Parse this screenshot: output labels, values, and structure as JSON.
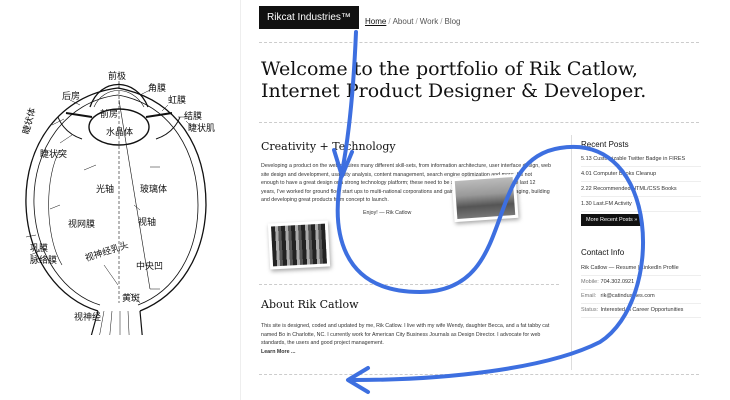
{
  "eye_labels": {
    "anterior_pole": "前极",
    "cornea": "角膜",
    "iris": "虹膜",
    "posterior_chamber": "后房",
    "anterior_chamber": "前房",
    "lens": "水晶体",
    "conjunctiva": "结膜",
    "ciliary_body_right": "睫状肌",
    "ciliary_body_left": "睫状体",
    "ciliary_process": "睫状突",
    "optic_axis": "光轴",
    "vitreous": "玻璃体",
    "visual_axis": "视轴",
    "retina": "视网膜",
    "sclera": "巩膜",
    "choroid": "脉络膜",
    "optic_disc": "视神经乳头",
    "fovea": "中央凹",
    "macula": "黄斑",
    "optic_nerve": "视神经"
  },
  "site": {
    "brand": "Rikcat Industries™",
    "nav": [
      "Home",
      "About",
      "Work",
      "Blog"
    ],
    "headline_line1": "Welcome to the portfolio of Rik Catlow,",
    "headline_line2": "Internet Product Designer & Developer.",
    "creativity": {
      "heading": "Creativity + Technology",
      "p1": "Developing a product on the web requires many different skill-sets, from information architecture, user interface design, web site design and development, usability analysis, content management, search engine optimization and more. It's not enough to have a great design or a strong technology platform; these need to be seamlessly integrated. In the last 12 years, I've worked for ground floor start ups to multi-national corporations and gained the experience for managing, building and developing great products from concept to launch.",
      "p2": "Enjoy! — Rik Catlow"
    },
    "about": {
      "heading": "About Rik Catlow",
      "text": "This site is designed, coded and updated by me, Rik Catlow. I live with my wife Wendy, daughter Becca, and a fat tabby cat named Bo in Charlotte, NC. I currently work for American City Business Journals as Design Director. I advocate for web standards, the users and good project management.",
      "more": "Learn More ..."
    },
    "recent_posts": {
      "heading": "Recent Posts",
      "items": [
        "5.13  Customizable Twitter Badge in FIRES",
        "4.01  Computer Books Cleanup",
        "2.22  Recommended HTML/CSS Books",
        "1.30  Last.FM Activity"
      ],
      "button": "More Recent Posts »"
    },
    "contact": {
      "heading": "Contact Info",
      "line1": "Rik Catlow — Resume | LinkedIn Profile",
      "mobile_label": "Mobile:",
      "mobile": "704.302.0921",
      "email_label": "Email:",
      "email": "rik@catindustries.com",
      "status_label": "Status:",
      "status": "Interested in Career Opportunities"
    }
  },
  "colors": {
    "arrow": "#3d6fe0",
    "brand_bg": "#111111"
  }
}
